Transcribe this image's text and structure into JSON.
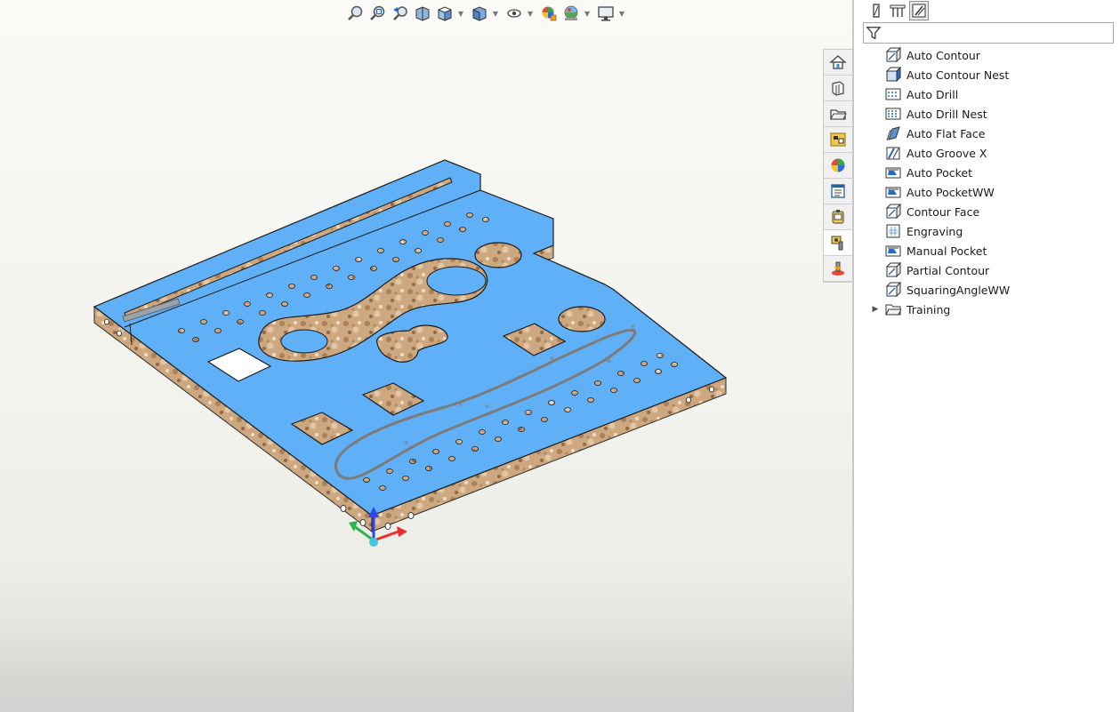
{
  "viewport": {
    "hud_toolbar": [
      {
        "name": "zoom-to-fit-icon",
        "caret": false
      },
      {
        "name": "zoom-to-area-icon",
        "caret": false
      },
      {
        "name": "previous-view-icon",
        "caret": false
      },
      {
        "name": "section-view-icon",
        "caret": false
      },
      {
        "name": "view-orientation-icon",
        "caret": true
      },
      {
        "name": "display-style-icon",
        "caret": true
      },
      {
        "name": "hide-show-items-icon",
        "caret": true
      },
      {
        "name": "edit-appearance-icon",
        "caret": false
      },
      {
        "name": "apply-scene-icon",
        "caret": true
      },
      {
        "name": "view-settings-icon",
        "caret": true
      }
    ]
  },
  "taskpane_tabs": [
    {
      "name": "home-icon",
      "active": false
    },
    {
      "name": "resources-icon",
      "active": false
    },
    {
      "name": "design-library-icon",
      "active": false
    },
    {
      "name": "file-explorer-icon",
      "active": false
    },
    {
      "name": "appearances-icon",
      "active": false
    },
    {
      "name": "custom-properties-icon",
      "active": false
    },
    {
      "name": "cam-library-icon",
      "active": false
    },
    {
      "name": "cam-tools-icon",
      "active": true
    },
    {
      "name": "cam-operations-icon",
      "active": false
    }
  ],
  "panel": {
    "tabs": [
      {
        "name": "feature-tree-icon",
        "active": false
      },
      {
        "name": "operation-tree-icon",
        "active": false
      },
      {
        "name": "operation-library-icon",
        "active": true
      }
    ],
    "filter": {
      "value": "",
      "placeholder": ""
    },
    "items": [
      {
        "label": "Auto Contour",
        "icon": "contour-icon"
      },
      {
        "label": "Auto Contour Nest",
        "icon": "contour-nest-icon"
      },
      {
        "label": "Auto Drill",
        "icon": "drill-icon"
      },
      {
        "label": "Auto Drill Nest",
        "icon": "drill-nest-icon"
      },
      {
        "label": "Auto Flat Face",
        "icon": "flat-face-icon"
      },
      {
        "label": "Auto Groove X",
        "icon": "groove-icon"
      },
      {
        "label": "Auto Pocket",
        "icon": "pocket-icon"
      },
      {
        "label": "Auto PocketWW",
        "icon": "pocket-icon"
      },
      {
        "label": "Contour Face",
        "icon": "contour-icon"
      },
      {
        "label": "Engraving",
        "icon": "engraving-icon"
      },
      {
        "label": "Manual Pocket",
        "icon": "pocket-icon"
      },
      {
        "label": "Partial Contour",
        "icon": "contour-icon"
      },
      {
        "label": "SquaringAngleWW",
        "icon": "contour-icon"
      },
      {
        "label": "Training",
        "icon": "folder-icon",
        "folder": true
      }
    ]
  },
  "colors": {
    "part_top": "#5fb0f7",
    "wood": "#c9a27a",
    "wood_dark": "#8f6a45",
    "spline": "#7b7b7b",
    "axis_x": "#e8312f",
    "axis_y": "#2fb34a",
    "axis_z": "#2f47e8"
  }
}
